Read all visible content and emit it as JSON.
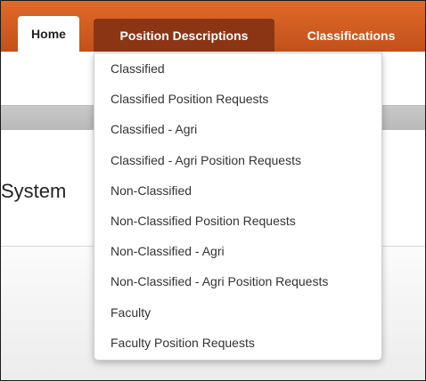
{
  "nav": {
    "tabs": [
      {
        "label": "Home"
      },
      {
        "label": "Position Descriptions"
      },
      {
        "label": "Classifications"
      }
    ]
  },
  "page": {
    "title_fragment": "System"
  },
  "dropdown": {
    "items": [
      {
        "label": "Classified"
      },
      {
        "label": "Classified Position Requests"
      },
      {
        "label": "Classified - Agri"
      },
      {
        "label": "Classified - Agri Position Requests"
      },
      {
        "label": "Non-Classified"
      },
      {
        "label": "Non-Classified Position Requests"
      },
      {
        "label": "Non-Classified - Agri"
      },
      {
        "label": "Non-Classified - Agri Position Requests"
      },
      {
        "label": "Faculty"
      },
      {
        "label": "Faculty Position Requests"
      }
    ]
  },
  "colors": {
    "navbar": "#d05d20",
    "active_tab": "#8c3514",
    "home_tab": "#ffffff",
    "band": "#c2c2c2"
  }
}
